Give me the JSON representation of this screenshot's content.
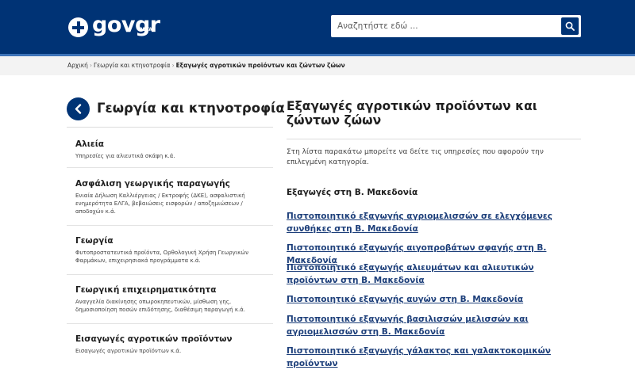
{
  "header": {
    "logo": {
      "name": "gov",
      "accent": "gr",
      "beta": "BETA"
    },
    "search": {
      "placeholder": "Αναζητήστε εδώ ..."
    }
  },
  "breadcrumb": {
    "items": [
      "Αρχική",
      "Γεωργία και κτηνοτροφία"
    ],
    "current": "Εξαγωγές αγροτικών προϊόντων και ζώντων ζώων"
  },
  "sidebar": {
    "title": "Γεωργία και κτηνοτροφία",
    "items": [
      {
        "title": "Αλιεία",
        "desc": "Υπηρεσίες για αλιευτικά σκάφη κ.ά."
      },
      {
        "title": "Ασφάλιση γεωργικής παραγωγής",
        "desc": "Ενιαία Δήλωση Καλλιέργειας / Εκτροφής (ΔΚΕ), ασφαλιστική ενημερότητα ΕΛΓΑ, βεβαιώσεις εισφορών / αποζημιώσεων / αποδοχών κ.ά."
      },
      {
        "title": "Γεωργία",
        "desc": "Φυτοπροστατευτικά προϊόντα, Ορθολογική Χρήση Γεωργικών Φαρμάκων, επιχειρησιακά προγράμματα κ.ά."
      },
      {
        "title": "Γεωργική επιχειρηματικότητα",
        "desc": "Αναγγελία διακίνησης οπωροκηπευτικών, μίσθωση γης, δημοσιοποίηση ποσών επιδότησης, διαθέσιμη παραγωγή κ.ά."
      },
      {
        "title": "Εισαγωγές αγροτικών προϊόντων",
        "desc": "Εισαγωγές αγροτικών προϊόντων κ.ά."
      }
    ]
  },
  "main": {
    "title": "Εξαγωγές αγροτικών προϊόντων και ζώντων ζώων",
    "intro": "Στη λίστα παρακάτω μπορείτε να δείτε τις υπηρεσίες που αφορούν την επιλεγμένη κατηγορία.",
    "section_heading": "Εξαγωγές στη Β. Μακεδονία",
    "links": [
      "Πιστοποιητικό εξαγωγής αγριομελισσών σε ελεγχόμενες συνθήκες στη Β. Μακεδονία",
      "Πιστοποιητικό εξαγωγής αιγοπροβάτων σφαγής στη Β. Μακεδονία",
      "Πιστοποιητικό εξαγωγής αλιευμάτων και αλιευτικών προϊόντων στη Β. Μακεδονία",
      "Πιστοποιητικό εξαγωγής αυγών στη Β. Μακεδονία",
      "Πιστοποιητικό εξαγωγής βασιλισσών μελισσών και αγριομελισσών στη Β. Μακεδονία",
      "Πιστοποιητικό εξαγωγής γάλακτος και γαλακτοκομικών προϊόντων"
    ]
  },
  "colors": {
    "header_bg": "#003375",
    "stripe": "#3d73b8",
    "link": "#1d3f7a",
    "crumb_bg": "#f3f3f3"
  },
  "icons": {
    "emblem": "greek-emblem-icon",
    "search": "search-icon",
    "back": "chevron-left-icon"
  }
}
